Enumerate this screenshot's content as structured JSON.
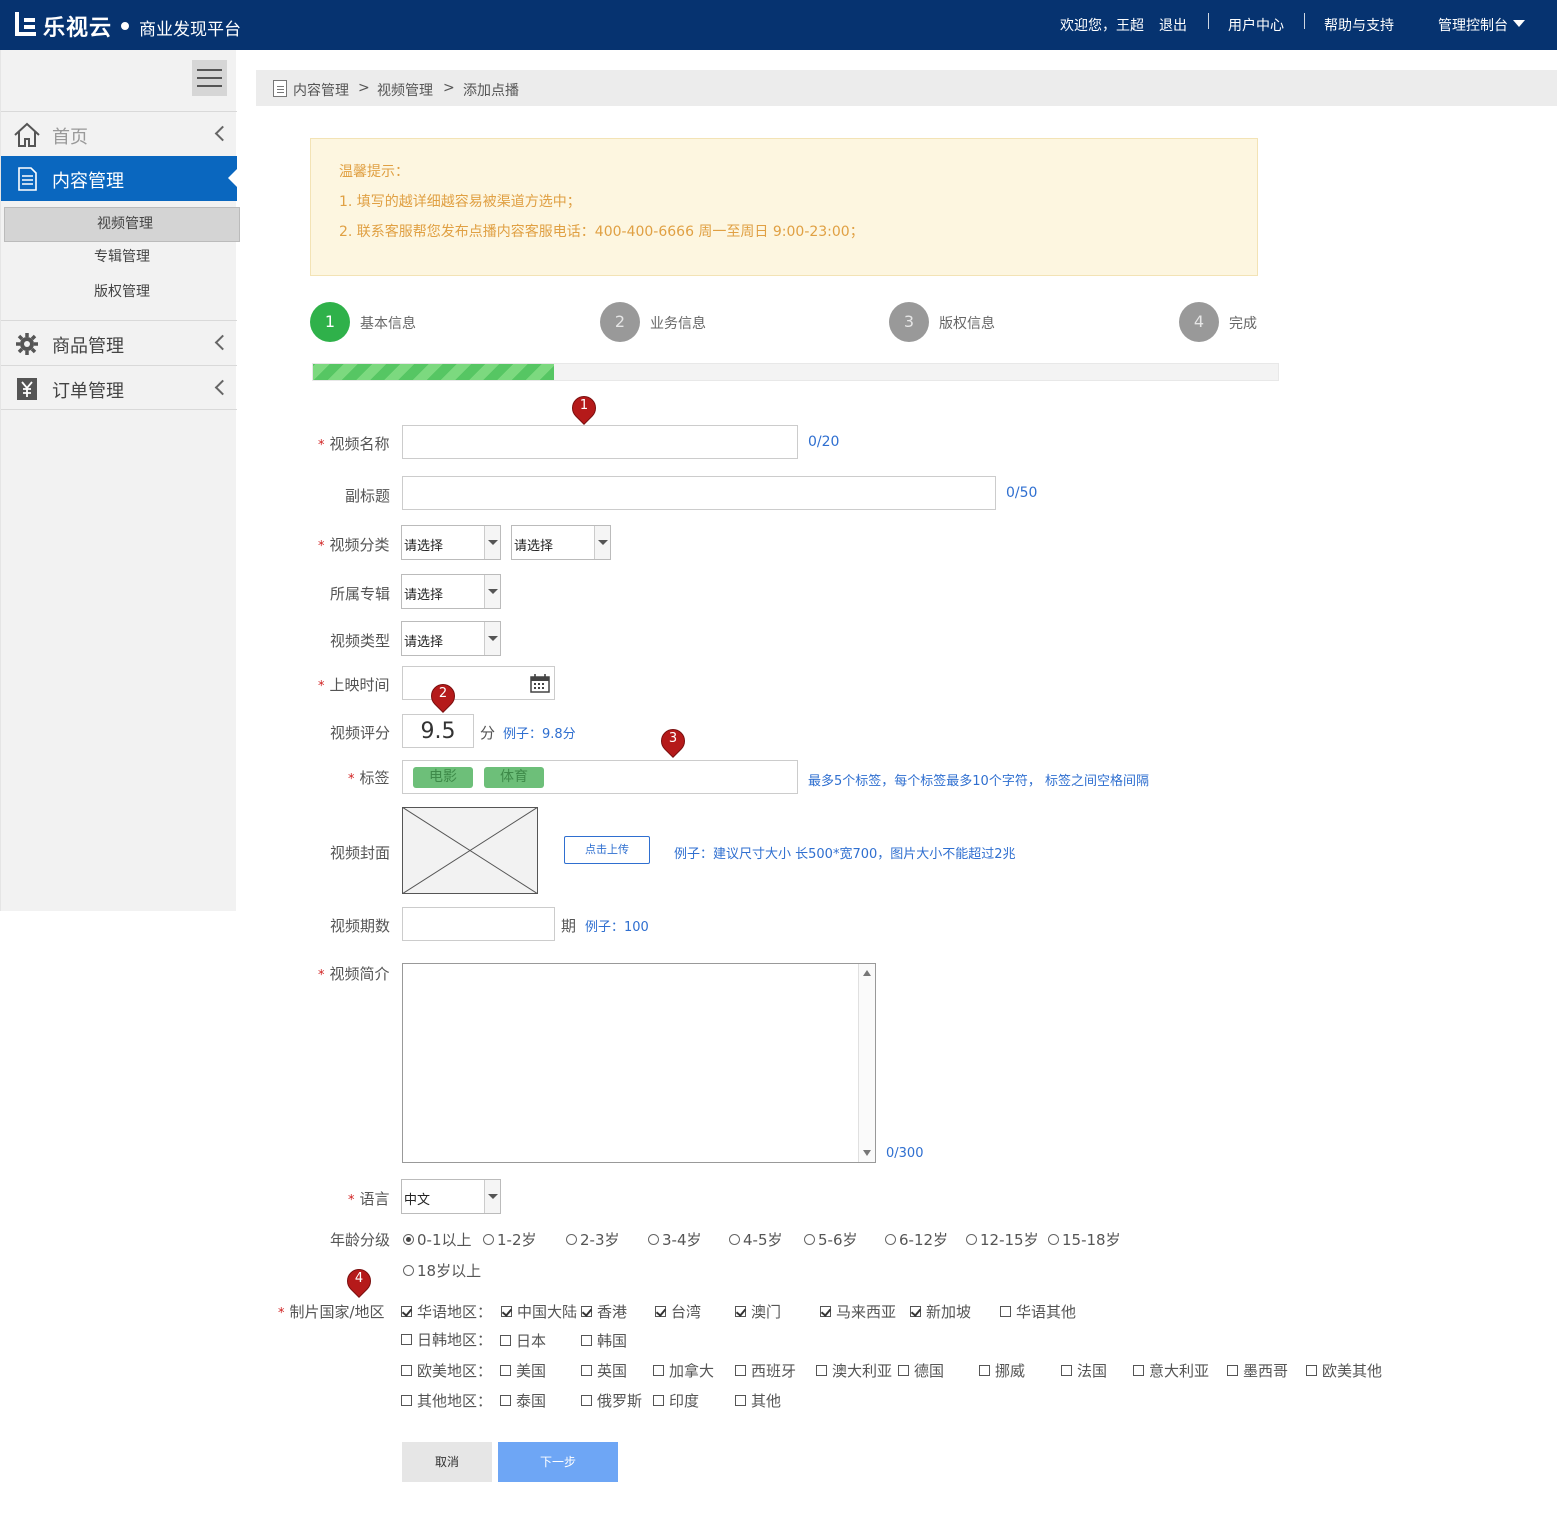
{
  "header": {
    "logo_text": "乐视云",
    "platform_name": "商业发现平台",
    "welcome": "欢迎您，王超",
    "logout": "退出",
    "user_center": "用户中心",
    "help": "帮助与支持",
    "console": "管理控制台"
  },
  "sidebar": {
    "home": "首页",
    "content_mgmt": "内容管理",
    "sub_items": [
      "视频管理",
      "专辑管理",
      "版权管理"
    ],
    "goods_mgmt": "商品管理",
    "order_mgmt": "订单管理"
  },
  "breadcrumb": [
    "内容管理",
    ">",
    "视频管理",
    ">",
    "添加点播"
  ],
  "tip": {
    "title": "温馨提示：",
    "line1": "1. 填写的越详细越容易被渠道方选中；",
    "line2": "2. 联系客服帮您发布点播内容客服电话：400-400-6666 周一至周日 9:00-23:00；"
  },
  "steps": [
    {
      "num": "1",
      "label": "基本信息"
    },
    {
      "num": "2",
      "label": "业务信息"
    },
    {
      "num": "3",
      "label": "版权信息"
    },
    {
      "num": "4",
      "label": "完成"
    }
  ],
  "progress_fraction": 0.25,
  "form": {
    "video_name": {
      "label": "视频名称",
      "count": "0/20"
    },
    "subtitle": {
      "label": "副标题",
      "count": "0/50"
    },
    "category": {
      "label": "视频分类",
      "select1": "请选择",
      "select2": "请选择"
    },
    "album": {
      "label": "所属专辑",
      "select": "请选择"
    },
    "type": {
      "label": "视频类型",
      "select": "请选择"
    },
    "release": {
      "label": "上映时间"
    },
    "score": {
      "label": "视频评分",
      "value": "9.5",
      "unit": "分",
      "hint": "例子：9.8分"
    },
    "tags": {
      "label": "标签",
      "items": [
        "电影",
        "体育"
      ],
      "hint": "最多5个标签，每个标签最多10个字符， 标签之间空格间隔"
    },
    "cover": {
      "label": "视频封面",
      "upload": "点击上传",
      "hint": "例子：建议尺寸大小 长500*宽700，图片大小不能超过2兆"
    },
    "episodes": {
      "label": "视频期数",
      "unit": "期",
      "hint": "例子：100"
    },
    "intro": {
      "label": "视频简介",
      "count": "0/300"
    },
    "language": {
      "label": "语言",
      "select": "中文"
    },
    "age": {
      "label": "年龄分级",
      "options": [
        "0-1以上",
        "1-2岁",
        "2-3岁",
        "3-4岁",
        "4-5岁",
        "5-6岁",
        "6-12岁",
        "12-15岁",
        "15-18岁",
        "18岁以上"
      ],
      "selected": "0-1以上"
    },
    "region": {
      "label": "制片国家/地区",
      "rows": [
        {
          "group": "华语地区：",
          "group_checked": true,
          "items": [
            {
              "name": "中国大陆",
              "checked": true
            },
            {
              "name": "香港",
              "checked": true
            },
            {
              "name": "台湾",
              "checked": true
            },
            {
              "name": "澳门",
              "checked": true
            },
            {
              "name": "马来西亚",
              "checked": true
            },
            {
              "name": "新加坡",
              "checked": true
            },
            {
              "name": "华语其他",
              "checked": false
            }
          ]
        },
        {
          "group": "日韩地区：",
          "group_checked": false,
          "items": [
            {
              "name": "日本",
              "checked": false
            },
            {
              "name": "韩国",
              "checked": false
            }
          ]
        },
        {
          "group": "欧美地区：",
          "group_checked": false,
          "items": [
            {
              "name": "美国",
              "checked": false
            },
            {
              "name": "英国",
              "checked": false
            },
            {
              "name": "加拿大",
              "checked": false
            },
            {
              "name": "西班牙",
              "checked": false
            },
            {
              "name": "澳大利亚",
              "checked": false
            },
            {
              "name": "德国",
              "checked": false
            },
            {
              "name": "挪威",
              "checked": false
            },
            {
              "name": "法国",
              "checked": false
            },
            {
              "name": "意大利亚",
              "checked": false
            },
            {
              "name": "墨西哥",
              "checked": false
            },
            {
              "name": "欧美其他",
              "checked": false
            }
          ]
        },
        {
          "group": "其他地区：",
          "group_checked": false,
          "items": [
            {
              "name": "泰国",
              "checked": false
            },
            {
              "name": "俄罗斯",
              "checked": false
            },
            {
              "name": "印度",
              "checked": false
            },
            {
              "name": "其他",
              "checked": false
            }
          ]
        }
      ]
    }
  },
  "buttons": {
    "cancel": "取消",
    "next": "下一步"
  },
  "markers": [
    "1",
    "2",
    "3",
    "4"
  ],
  "colors": {
    "header": "#063370",
    "active_nav": "#0a67bf",
    "step_active": "#2fb14a",
    "step_inactive": "#999999",
    "link": "#2f6fd0",
    "next_button": "#6ea6f5"
  }
}
